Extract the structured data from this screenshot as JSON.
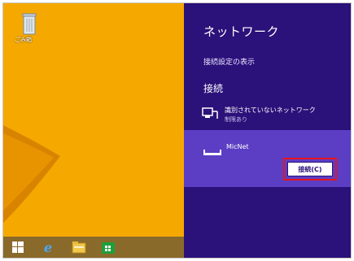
{
  "desktop": {
    "recycle_bin_label": "ごみ箱",
    "taskbar": {
      "icons": [
        "windows-start-icon",
        "internet-explorer-icon",
        "file-explorer-icon",
        "store-icon"
      ]
    }
  },
  "network_pane": {
    "title": "ネットワーク",
    "connection_settings_link": "接続設定の表示",
    "section_label": "接続",
    "networks": [
      {
        "name": "識別されていないネットワーク",
        "status": "制限あり",
        "icon": "ethernet-icon"
      },
      {
        "name": "MicNet",
        "icon": "wireless-network-icon",
        "action_label": "接続(C)"
      }
    ]
  },
  "colors": {
    "charm_background": "#2b117a",
    "selected_network": "#5b3ec4",
    "desktop_background": "#f5a800",
    "highlight_border": "#e8141c"
  }
}
